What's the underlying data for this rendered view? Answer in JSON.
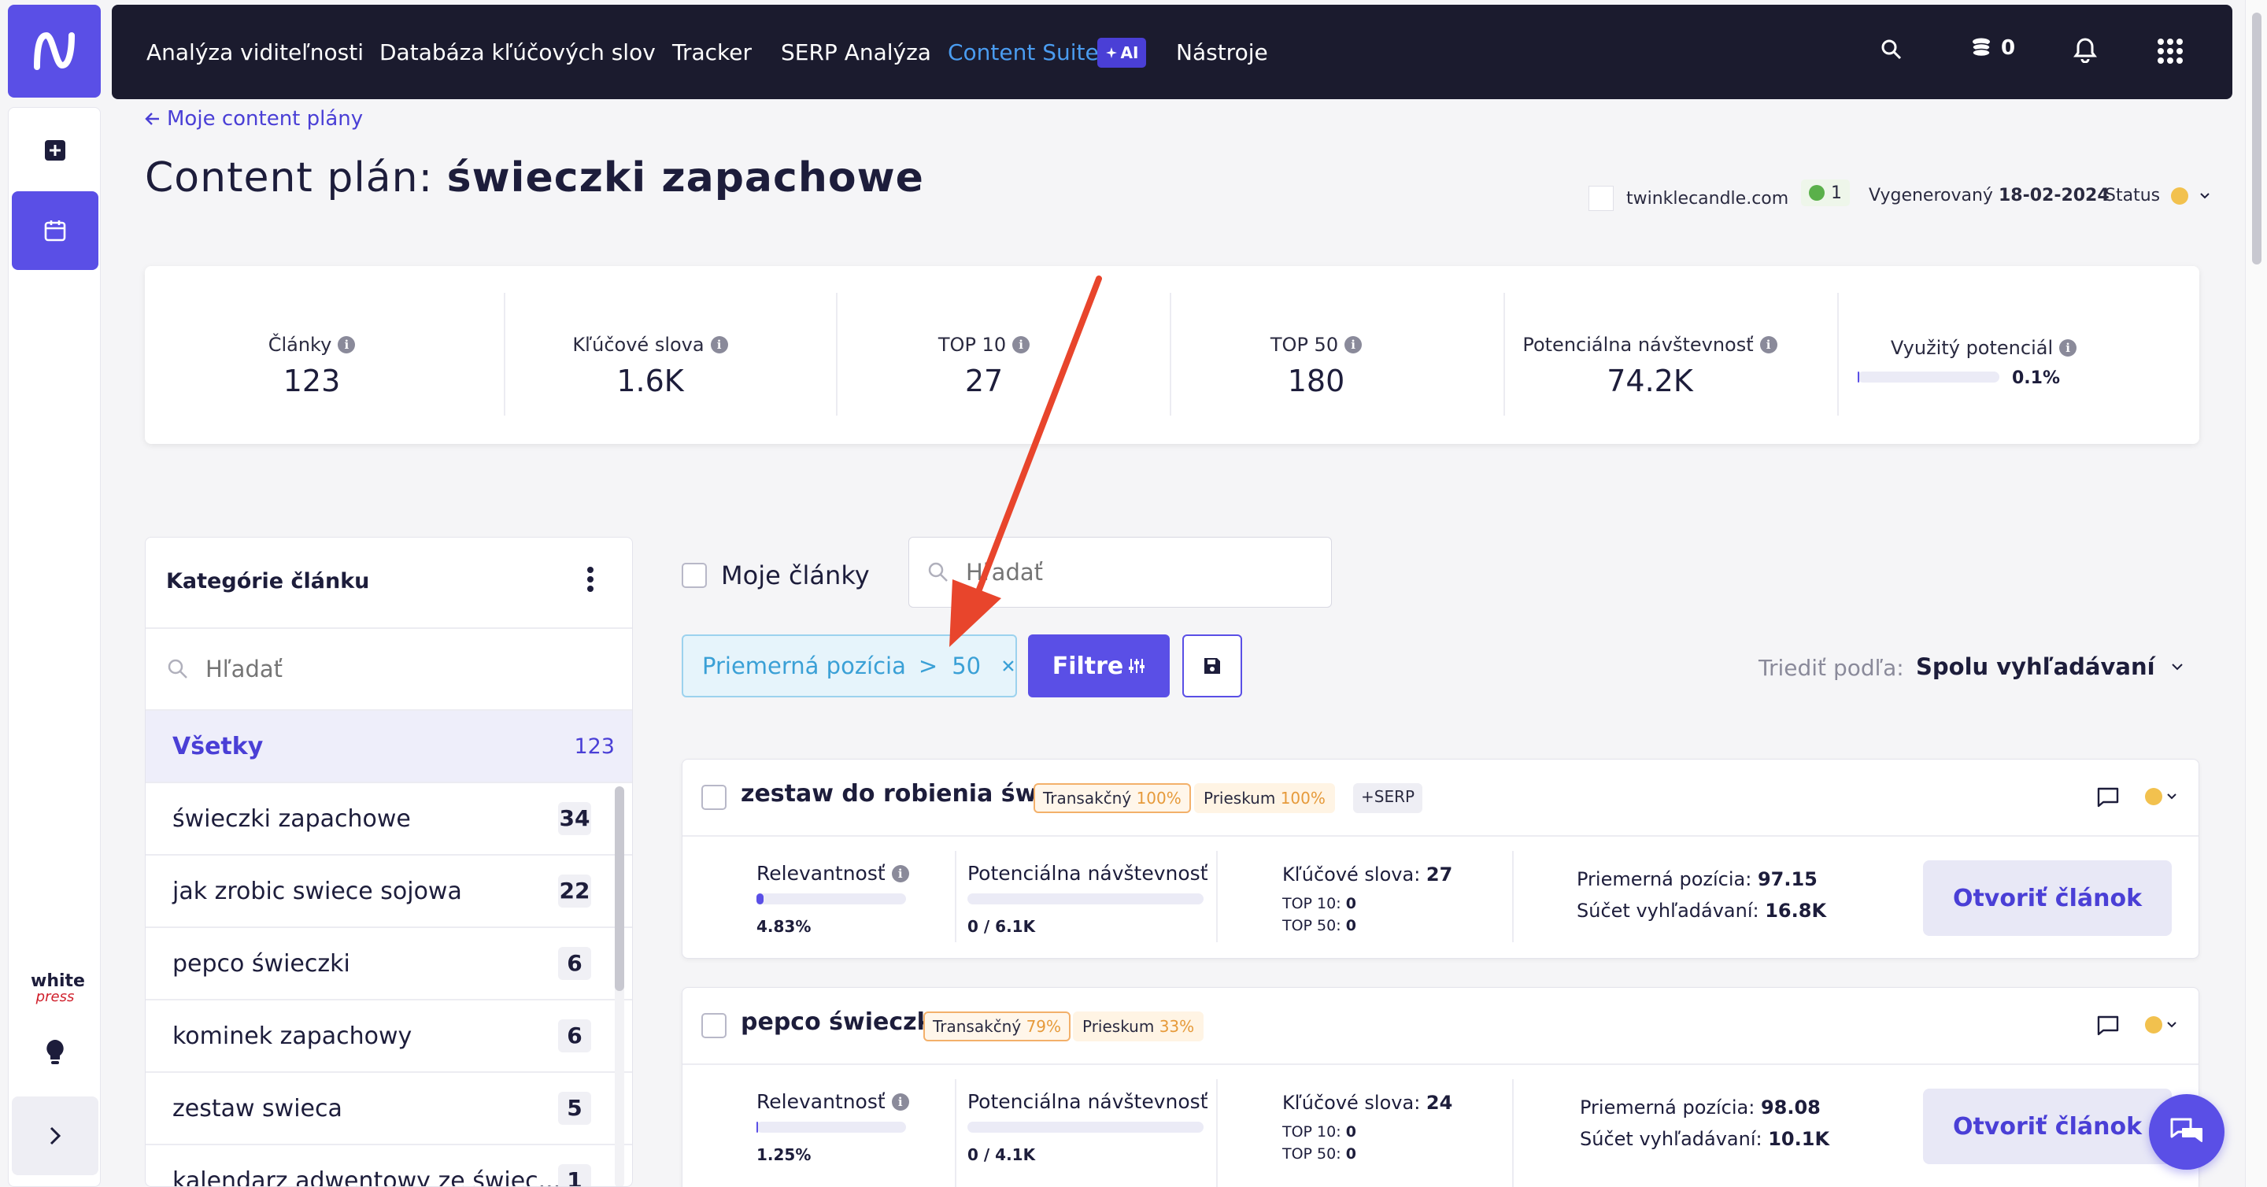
{
  "nav": {
    "items": [
      "Analýza viditeľnosti",
      "Databáza kľúčových slov",
      "Tracker",
      "SERP Analýza",
      "Content Suite",
      "Nástroje"
    ],
    "ai_badge": "AI",
    "credits": "0"
  },
  "sidebar": {
    "brand_top": "white",
    "brand_bottom": "press"
  },
  "header": {
    "back_link": "Moje content plány",
    "title_prefix": "Content plán:",
    "title_keyword": "świeczki zapachowe",
    "domain": "twinklecandle.com",
    "badge_count": "1",
    "generated_label": "Vygenerovaný",
    "generated_date": "18-02-2024",
    "status_label": "Status"
  },
  "stats": [
    {
      "label": "Články",
      "value": "123"
    },
    {
      "label": "Kľúčové slova",
      "value": "1.6K"
    },
    {
      "label": "TOP 10",
      "value": "27"
    },
    {
      "label": "TOP 50",
      "value": "180"
    },
    {
      "label": "Potenciálna návštevnosť",
      "value": "74.2K"
    },
    {
      "label": "Využitý potenciál",
      "value": "0.1%"
    }
  ],
  "used_potential_fraction": 0.001,
  "categories": {
    "title": "Kategórie článku",
    "search_placeholder": "Hľadať",
    "all_label": "Všetky",
    "all_count": "123",
    "items": [
      {
        "name": "świeczki zapachowe",
        "count": "34"
      },
      {
        "name": "jak zrobic swiece sojowa",
        "count": "22"
      },
      {
        "name": "pepco świeczki",
        "count": "6"
      },
      {
        "name": "kominek zapachowy",
        "count": "6"
      },
      {
        "name": "zestaw swieca",
        "count": "5"
      },
      {
        "name": "kalendarz adwentowy ze świec...",
        "count": "1"
      }
    ]
  },
  "toolbar": {
    "my_articles": "Moje články",
    "search_placeholder": "Hľadať",
    "filter_chip_label": "Priemerná pozícia",
    "filter_chip_op": ">",
    "filter_chip_value": "50",
    "filters_button": "Filtre",
    "sort_label": "Triediť podľa:",
    "sort_value": "Spolu vyhľadávaní"
  },
  "articles": [
    {
      "title": "zestaw do robienia świec",
      "tags": [
        {
          "name": "Transakčný",
          "pct": "100%"
        },
        {
          "name": "Prieskum",
          "pct": "100%"
        }
      ],
      "serp_tag": "+SERP",
      "relevance_label": "Relevantnosť",
      "relevance_value": "4.83%",
      "relevance_fraction": 0.0483,
      "traffic_label": "Potenciálna návštevnosť",
      "traffic_value": "0 / 6.1K",
      "keywords_label": "Kľúčové slova:",
      "keywords_value": "27",
      "top10_label": "TOP 10:",
      "top10_value": "0",
      "top50_label": "TOP 50:",
      "top50_value": "0",
      "avg_pos_label": "Priemerná pozícia:",
      "avg_pos_value": "97.15",
      "search_sum_label": "Súčet vyhľadávaní:",
      "search_sum_value": "16.8K",
      "open_button": "Otvoriť článok"
    },
    {
      "title": "pepco świeczki",
      "tags": [
        {
          "name": "Transakčný",
          "pct": "79%"
        },
        {
          "name": "Prieskum",
          "pct": "33%"
        }
      ],
      "serp_tag": "",
      "relevance_label": "Relevantnosť",
      "relevance_value": "1.25%",
      "relevance_fraction": 0.0125,
      "traffic_label": "Potenciálna návštevnosť",
      "traffic_value": "0 / 4.1K",
      "keywords_label": "Kľúčové slova:",
      "keywords_value": "24",
      "top10_label": "TOP 10:",
      "top10_value": "0",
      "top50_label": "TOP 50:",
      "top50_value": "0",
      "avg_pos_label": "Priemerná pozícia:",
      "avg_pos_value": "98.08",
      "search_sum_label": "Súčet vyhľadávaní:",
      "search_sum_value": "10.1K",
      "open_button": "Otvoriť článok"
    }
  ],
  "colors": {
    "accent": "#5a4fe6",
    "topbar": "#1b1b2e",
    "link": "#4a9cf0",
    "arrow": "#e8452c",
    "status": "#f2c14e"
  }
}
